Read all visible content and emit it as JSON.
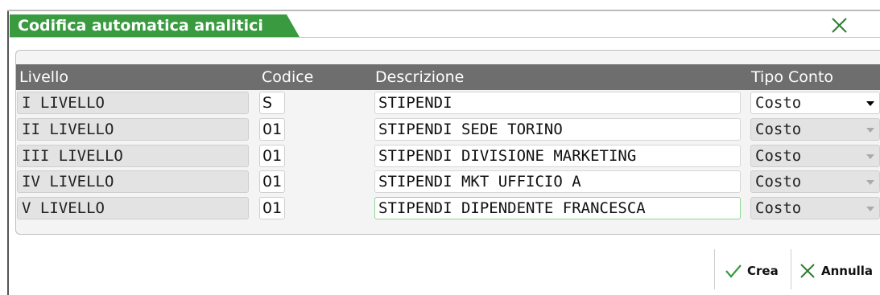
{
  "dialog": {
    "title": "Codifica automatica analitici"
  },
  "table": {
    "headers": {
      "livello": "Livello",
      "codice": "Codice",
      "descrizione": "Descrizione",
      "tipo_conto": "Tipo Conto"
    },
    "rows": [
      {
        "livello": "I LIVELLO",
        "codice": "S",
        "descrizione": "STIPENDI",
        "tipo_conto": "Costo"
      },
      {
        "livello": "II LIVELLO",
        "codice": "01",
        "descrizione": "STIPENDI SEDE TORINO",
        "tipo_conto": "Costo"
      },
      {
        "livello": "III LIVELLO",
        "codice": "01",
        "descrizione": "STIPENDI DIVISIONE MARKETING",
        "tipo_conto": "Costo"
      },
      {
        "livello": "IV LIVELLO",
        "codice": "01",
        "descrizione": "STIPENDI MKT UFFICIO A",
        "tipo_conto": "Costo"
      },
      {
        "livello": "V LIVELLO",
        "codice": "01",
        "descrizione": "STIPENDI DIPENDENTE FRANCESCA",
        "tipo_conto": "Costo"
      }
    ]
  },
  "footer": {
    "crea_label": "Crea",
    "annulla_label": "Annulla"
  },
  "icons": {
    "close": "close-x-icon",
    "crea": "checkmark-icon",
    "annulla": "x-icon"
  },
  "colors": {
    "title_bg": "#3a9a3f",
    "header_bg": "#6e6e6e",
    "check": "#3a9a3f"
  }
}
